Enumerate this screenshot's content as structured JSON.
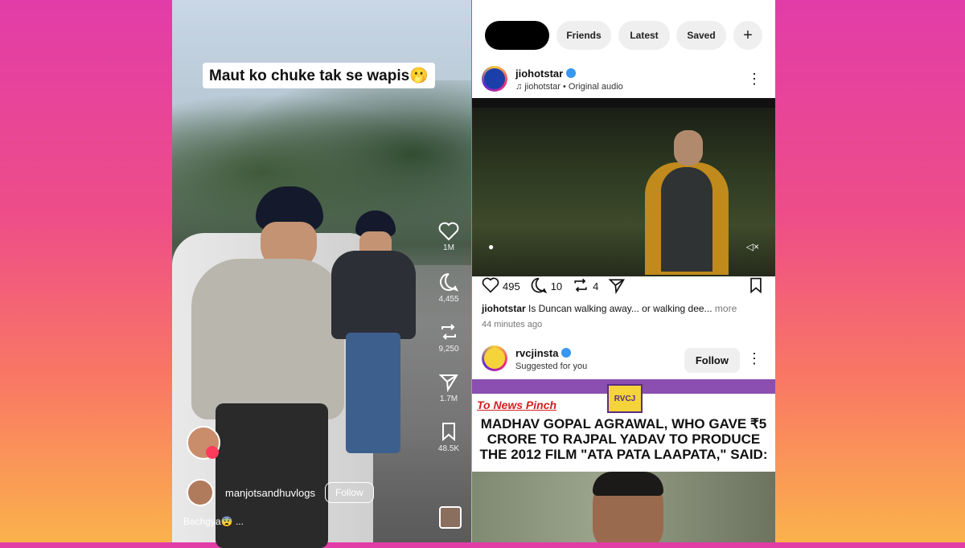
{
  "reel": {
    "caption": "Maut ko chuke tak se wapis🫢",
    "actions": [
      {
        "icon": "heart-icon",
        "count": "1M"
      },
      {
        "icon": "comment-icon",
        "count": "4,455"
      },
      {
        "icon": "repost-icon",
        "count": "9,250"
      },
      {
        "icon": "share-icon",
        "count": "1.7M"
      },
      {
        "icon": "bookmark-icon",
        "count": "48.5K"
      }
    ],
    "username": "manjotsandhuvlogs",
    "follow_label": "Follow",
    "description": "Bachgya😨 ..."
  },
  "feed": {
    "tabs": [
      "Friends",
      "Latest",
      "Saved"
    ],
    "add_icon": "plus-icon",
    "post1": {
      "username": "jiohotstar",
      "audio": "jiohotstar • Original audio",
      "likes": "495",
      "comments": "10",
      "reposts": "4",
      "caption_user": "jiohotstar",
      "caption_text": " Is Duncan walking away... or walking dee...",
      "more": "more",
      "time": "44 minutes ago"
    },
    "post2": {
      "username": "rvcjinsta",
      "subtitle": "Suggested for you",
      "follow_label": "Follow",
      "logo_text": "RVCJ",
      "tag": "To News Pinch",
      "headline": "MADHAV GOPAL AGRAWAL, WHO GAVE ₹5 CRORE TO RAJPAL YADAV TO PRODUCE THE 2012 FILM \"ATA PATA LAAPATA,\" SAID:"
    }
  },
  "colors": {
    "verified": "#3897f0",
    "accent_gradient": [
      "#e23ca8",
      "#fbb24c"
    ]
  }
}
